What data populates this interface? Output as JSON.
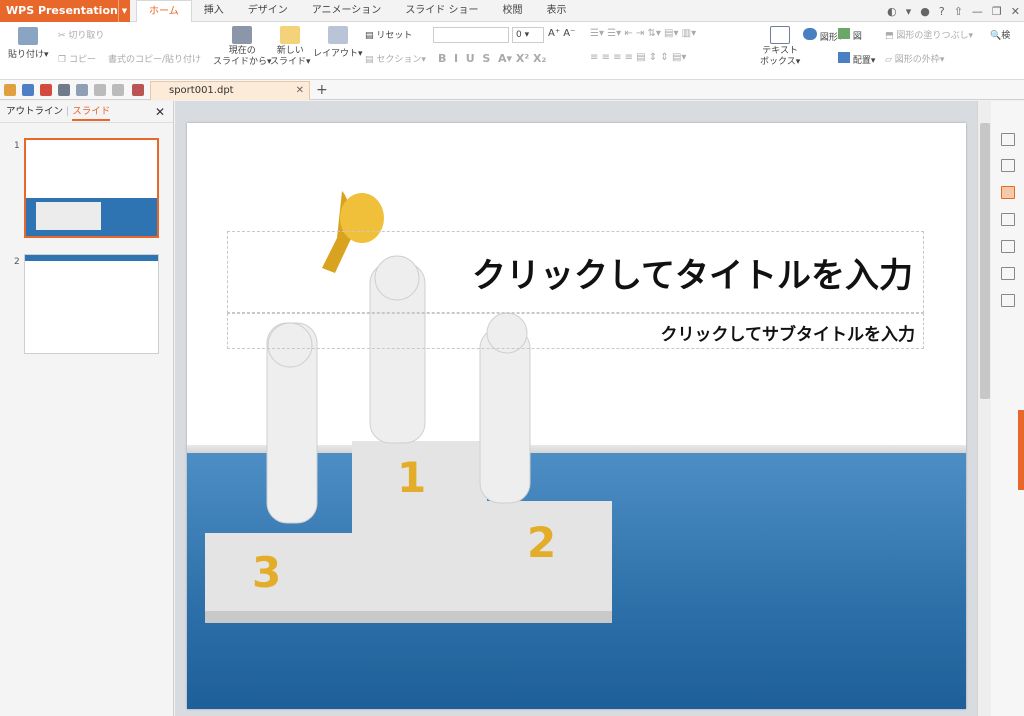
{
  "app": {
    "title": "WPS Presentation"
  },
  "tabs": [
    "ホーム",
    "挿入",
    "デザイン",
    "アニメーション",
    "スライド ショー",
    "校閲",
    "表示"
  ],
  "ribbon": {
    "paste": "貼り付け",
    "cut": "切り取り",
    "copy": "コピー",
    "format_painter": "書式のコピー/貼り付け",
    "from_current_1": "現在の",
    "from_current_2": "スライドから",
    "new_slide_1": "新しい",
    "new_slide_2": "スライド",
    "layout": "レイアウト",
    "reset": "リセット",
    "section": "セクション",
    "font_size": "0",
    "text_box_1": "テキスト",
    "text_box_2": "ボックス",
    "shape": "図形",
    "picture": "図",
    "arrange": "配置",
    "shape_fill": "図形の塗りつぶし",
    "shape_outline": "図形の外枠",
    "find": "検"
  },
  "document": {
    "tab_name": "sport001.dpt"
  },
  "left_panel": {
    "outline_tab": "アウトライン",
    "slides_tab": "スライド",
    "slides": [
      "1",
      "2"
    ]
  },
  "slide": {
    "title": "クリックしてタイトルを入力",
    "subtitle": "クリックしてサブタイトルを入力",
    "podium": {
      "first": "1",
      "second": "2",
      "third": "3"
    }
  },
  "colors": {
    "accent": "#e8672b",
    "floor": "#2d6fa8"
  }
}
